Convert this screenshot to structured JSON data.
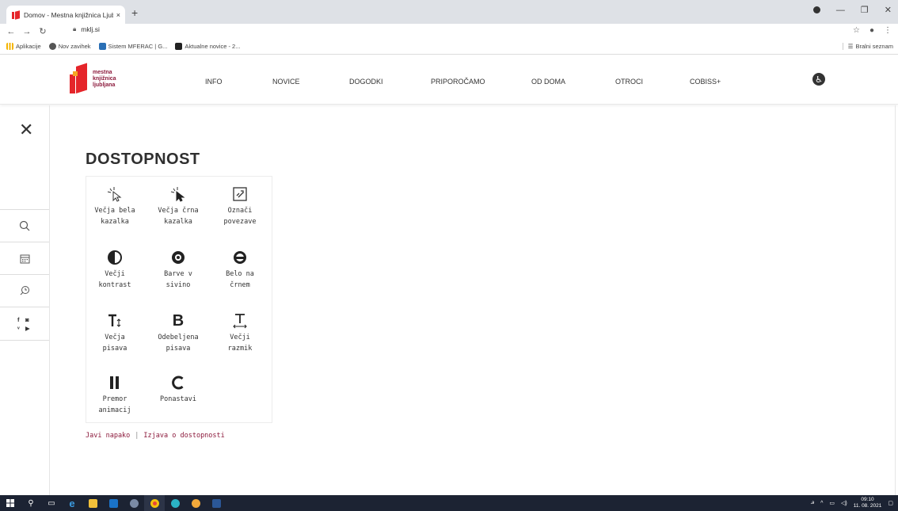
{
  "browser": {
    "tab_title": "Domov - Mestna knjižnica Ljublja",
    "tab_close": "×",
    "new_tab": "+",
    "url": "mklj.si",
    "bookmarks": [
      {
        "label": "Aplikacije",
        "icon": "apps-grid-icon"
      },
      {
        "label": "Nov zavihek",
        "icon": "globe-icon"
      },
      {
        "label": "Sistem MFERAC | G...",
        "icon": "shield-icon"
      },
      {
        "label": "Aktualne novice - 2...",
        "icon": "news-icon"
      }
    ],
    "reading_list": "Bralni seznam"
  },
  "site": {
    "logo_lines": [
      "mestna",
      "knjižnica",
      "ljubljana"
    ],
    "nav": [
      "INFO",
      "NOVICE",
      "DOGODKI",
      "PRIPOROČAMO",
      "OD DOMA",
      "OTROCI",
      "COBISS+"
    ],
    "brand_color": "#e5252a",
    "accent_color": "#8c1a3c"
  },
  "accessibility": {
    "title": "DOSTOPNOST",
    "options": [
      {
        "label": "Večja bela\nkazalka",
        "icon": "white-cursor-icon"
      },
      {
        "label": "Večja črna\nkazalka",
        "icon": "black-cursor-icon"
      },
      {
        "label": "Označi\npovezave",
        "icon": "link-highlight-icon"
      },
      {
        "label": "Večji\nkontrast",
        "icon": "contrast-icon"
      },
      {
        "label": "Barve v\nsivino",
        "icon": "grayscale-icon"
      },
      {
        "label": "Belo na\nčrnem",
        "icon": "invert-icon"
      },
      {
        "label": "Večja\npisava",
        "icon": "font-size-icon"
      },
      {
        "label": "Odebeljena\npisava",
        "icon": "bold-icon"
      },
      {
        "label": "Večji\nrazmik",
        "icon": "spacing-icon"
      },
      {
        "label": "Premor\nanimacij",
        "icon": "pause-icon"
      },
      {
        "label": "Ponastavi",
        "icon": "reset-icon"
      }
    ],
    "report_error": "Javi napako",
    "separator": "|",
    "statement": "Izjava o dostopnosti"
  },
  "taskbar": {
    "time": "09:10",
    "date": "11. 08. 2021"
  }
}
